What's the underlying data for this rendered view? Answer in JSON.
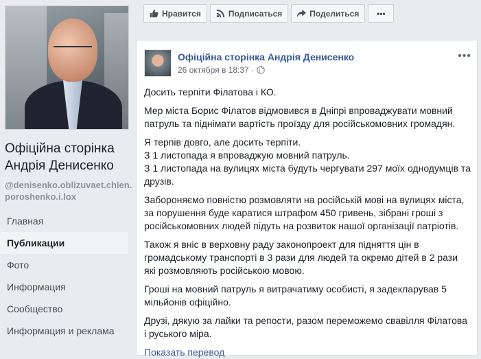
{
  "page": {
    "name": "Офіційна сторінка Андрія Денисенко",
    "handle": "@denisenko.oblizuvaet.chlen.poroshenko.i.lox"
  },
  "nav": [
    {
      "label": "Главная"
    },
    {
      "label": "Публикации"
    },
    {
      "label": "Фото"
    },
    {
      "label": "Информация"
    },
    {
      "label": "Сообщество"
    },
    {
      "label": "Информация и реклама"
    }
  ],
  "actions": {
    "like": "Нравится",
    "subscribe": "Подписаться",
    "share": "Поделиться"
  },
  "post": {
    "author": "Офіційна сторінка Андрія Денисенко",
    "date": "26 октября в 18:37 ·",
    "paragraphs": [
      "Досить терпіти Філатова і КО.",
      "Мер міста Борис Філатов відмовився в Дніпрі впроваджувати мовний патруль та піднімати вартість проїзду для російськомовних громадян.",
      "Я терпів довго, але досить терпіти.",
      "З 1 листопада я впроваджую мовний патруль.",
      "З 1 листопада на вулицях міста будуть чергувати 297 моїх однодумців та друзів.",
      "Забороняємо повністю розмовляти на російській мові на вулицях міста, за порушення буде каратися штрафом 450 гривень, зібрані гроші з російськомовних людей підуть на розвиток нашої організації патріотів.",
      "Також я вніс в верховну раду законопроект для підняття цін в громадському транспорті в 3 рази для людей та окремо дітей в 2 рази які розмовляють російською мовою.",
      "Гроші на мовний патруль я витрачатиму особисті, я задекларував 5 мільйонів офіційно.",
      "Друзі, дякую за лайки та репости, разом переможемо свавілля Філатова і руського міра."
    ],
    "translate_link": "Показать перевод"
  }
}
